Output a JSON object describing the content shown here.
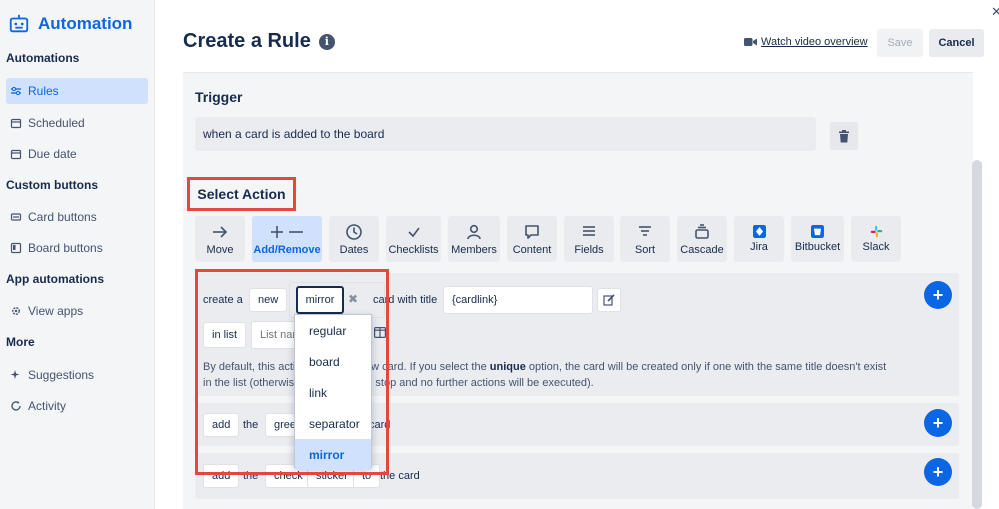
{
  "sidebar": {
    "brand_title": "Automation",
    "sections": [
      {
        "title": "Automations",
        "items": [
          {
            "label": "Rules",
            "icon": "sliders-icon",
            "active": true
          },
          {
            "label": "Scheduled",
            "icon": "calendar-icon"
          },
          {
            "label": "Due date",
            "icon": "calendar-icon"
          }
        ]
      },
      {
        "title": "Custom buttons",
        "items": [
          {
            "label": "Card buttons",
            "icon": "card-icon"
          },
          {
            "label": "Board buttons",
            "icon": "board-icon"
          }
        ]
      },
      {
        "title": "App automations",
        "items": [
          {
            "label": "View apps",
            "icon": "gear-icon"
          }
        ]
      },
      {
        "title": "More",
        "items": [
          {
            "label": "Suggestions",
            "icon": "sparkle-icon"
          },
          {
            "label": "Activity",
            "icon": "refresh-icon"
          }
        ]
      }
    ]
  },
  "header": {
    "title": "Create a Rule",
    "watch_video": "Watch video overview",
    "save": "Save",
    "cancel": "Cancel"
  },
  "trigger": {
    "title": "Trigger",
    "text": "when a card is added to the board"
  },
  "select_action": {
    "title": "Select Action",
    "tabs": [
      "Move",
      "Add/Remove",
      "Dates",
      "Checklists",
      "Members",
      "Content",
      "Fields",
      "Sort",
      "Cascade",
      "Jira",
      "Bitbucket",
      "Slack"
    ],
    "active_tab": "Add/Remove"
  },
  "action1": {
    "create_a": "create a",
    "new": "new",
    "mirror": "mirror",
    "card_with_title": "card with title",
    "title_value": "{cardlink}",
    "in_list": "in list",
    "list_placeholder": "List name",
    "desc_prefix": "By default, this action creates a new card. If you select the ",
    "desc_unique": "unique",
    "desc_suffix": " option, the card will be created only if one with the same title doesn't exist",
    "desc_line2": "in the list (otherwise, the action will stop and no further actions will be executed)."
  },
  "action2": {
    "add": "add",
    "the": "the",
    "green": "green",
    "card": "card"
  },
  "action3": {
    "add": "add",
    "the": "the",
    "check": "check",
    "sticker": "sticker",
    "to": "to",
    "the_card": "the card"
  },
  "dropdown": {
    "options": [
      "regular",
      "board",
      "link",
      "separator",
      "mirror"
    ],
    "selected": "mirror"
  },
  "colors": {
    "accent": "#0c66e4",
    "highlight": "#e5463e"
  }
}
